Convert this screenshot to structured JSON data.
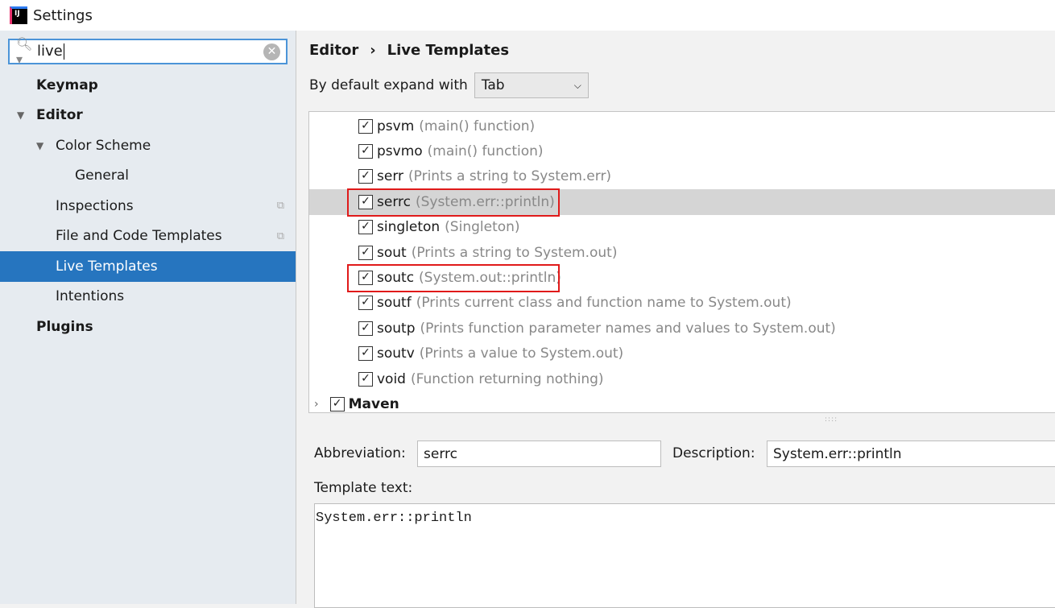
{
  "window": {
    "title": "Settings",
    "logo_text": "IJ"
  },
  "search": {
    "value": "live"
  },
  "sidebar": {
    "items": [
      {
        "label": "Keymap"
      },
      {
        "label": "Editor"
      },
      {
        "label": "Color Scheme"
      },
      {
        "label": "General"
      },
      {
        "label": "Inspections"
      },
      {
        "label": "File and Code Templates"
      },
      {
        "label": "Live Templates"
      },
      {
        "label": "Intentions"
      },
      {
        "label": "Plugins"
      }
    ]
  },
  "breadcrumb": {
    "parent": "Editor",
    "separator": "›",
    "current": "Live Templates"
  },
  "expand": {
    "label": "By default expand with",
    "value": "Tab"
  },
  "templates": [
    {
      "abbr": "psvm",
      "desc": "(main() function)",
      "checked": true
    },
    {
      "abbr": "psvmo",
      "desc": "(main() function)",
      "checked": true
    },
    {
      "abbr": "serr",
      "desc": "(Prints a string to System.err)",
      "checked": true
    },
    {
      "abbr": "serrc",
      "desc": "(System.err::println)",
      "checked": true,
      "selected": true,
      "highlighted": true
    },
    {
      "abbr": "singleton",
      "desc": "(Singleton)",
      "checked": true
    },
    {
      "abbr": "sout",
      "desc": "(Prints a string to System.out)",
      "checked": true
    },
    {
      "abbr": "soutc",
      "desc": "(System.out::println)",
      "checked": true,
      "highlighted": true
    },
    {
      "abbr": "soutf",
      "desc": "(Prints current class and function name to System.out)",
      "checked": true
    },
    {
      "abbr": "soutp",
      "desc": "(Prints function parameter names and values to System.out)",
      "checked": true
    },
    {
      "abbr": "soutv",
      "desc": "(Prints a value to System.out)",
      "checked": true
    },
    {
      "abbr": "void",
      "desc": "(Function returning nothing)",
      "checked": true
    }
  ],
  "group": {
    "label": "Maven",
    "checked": true
  },
  "editor": {
    "abbreviation_label": "Abbreviation:",
    "abbreviation": "serrc",
    "description_label": "Description:",
    "description": "System.err::println",
    "template_label": "Template text:",
    "template_text": "System.err::println"
  },
  "colors": {
    "selection": "#2675bf",
    "highlight_box": "#e01a1a",
    "search_border": "#4b94d8"
  }
}
